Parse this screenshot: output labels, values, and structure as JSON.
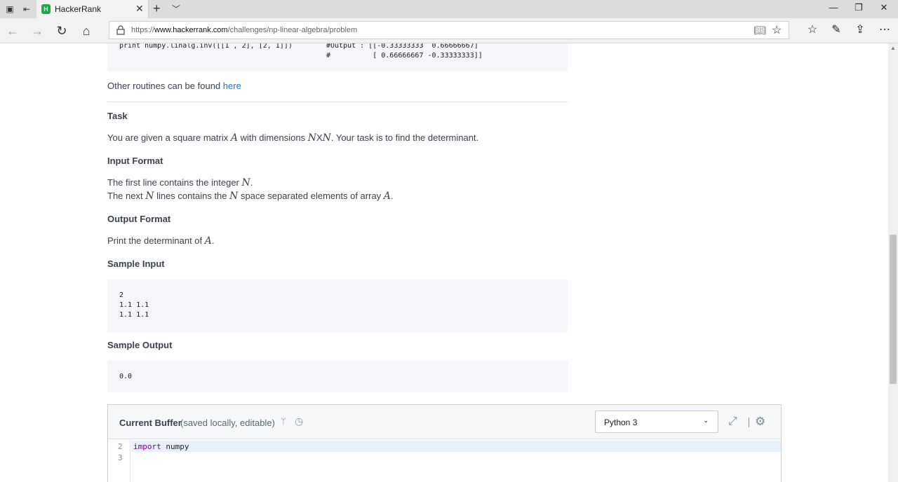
{
  "browser": {
    "tab_title": "HackerRank",
    "tab_favicon": "H",
    "url_prefix": "https://",
    "url_domain": "www.hackerrank.com",
    "url_path": "/challenges/np-linear-algebra/problem"
  },
  "page": {
    "code_example": {
      "line1_code": "print numpy.linalg.inv([[1 , 2], [2, 1]])",
      "line1_comment": "#Output : [[-0.33333333  0.66666667]",
      "line2_comment": "#          [ 0.66666667 -0.33333333]]"
    },
    "other_routines_text": "Other routines can be found ",
    "other_routines_link": "here",
    "task": {
      "heading": "Task",
      "text_1": "You are given a square matrix ",
      "var_a": "A",
      "text_2": " with dimensions ",
      "dims": "N",
      "dims_x": "X",
      "dims_n": "N",
      "text_3": ". Your task is to find the determinant."
    },
    "input_format": {
      "heading": "Input Format",
      "line1_pre": "The first line contains the integer ",
      "line1_var": "N",
      "line1_post": ".",
      "line2_pre": "The next ",
      "line2_var": "N",
      "line2_mid": " lines contains the ",
      "line2_var2": "N",
      "line2_mid2": " space separated elements of array ",
      "line2_var3": "A",
      "line2_post": "."
    },
    "output_format": {
      "heading": "Output Format",
      "text_pre": "Print the determinant of ",
      "var": "A",
      "text_post": "."
    },
    "sample_input": {
      "heading": "Sample Input",
      "lines": [
        "2",
        "1.1 1.1",
        "1.1 1.1"
      ]
    },
    "sample_output": {
      "heading": "Sample Output",
      "value": "0.0"
    }
  },
  "editor": {
    "title": "Current Buffer",
    "note": "(saved locally, editable)",
    "language": "Python 3",
    "line_numbers": [
      "2",
      "3"
    ],
    "code_keyword": "import",
    "code_rest": " numpy"
  },
  "icons": {
    "back": "arrow-left-icon",
    "forward": "arrow-right-icon",
    "refresh": "refresh-icon",
    "home": "home-icon",
    "favorites": "favorites-icon",
    "notes": "pen-icon",
    "share": "share-icon",
    "more": "more-icon"
  }
}
